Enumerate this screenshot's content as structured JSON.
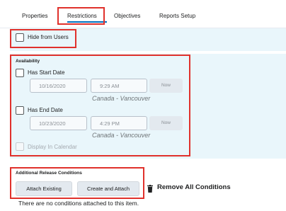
{
  "tabs": [
    {
      "label": "Properties"
    },
    {
      "label": "Restrictions",
      "active": true
    },
    {
      "label": "Objectives"
    },
    {
      "label": "Reports Setup"
    }
  ],
  "hide": {
    "label": "Hide from Users",
    "checked": false
  },
  "availability": {
    "heading": "Availability",
    "start": {
      "label": "Has Start Date",
      "checked": false,
      "date": "10/16/2020",
      "time": "9:29 AM",
      "now": "Now",
      "timezone": "Canada - Vancouver"
    },
    "end": {
      "label": "Has End Date",
      "checked": false,
      "date": "10/23/2020",
      "time": "4:29 PM",
      "now": "Now",
      "timezone": "Canada - Vancouver"
    },
    "calendar": {
      "label": "Display In Calendar",
      "checked": false,
      "disabled": true
    }
  },
  "release": {
    "heading": "Additional Release Conditions",
    "attach_existing": "Attach Existing",
    "create_attach": "Create and Attach",
    "remove_all": "Remove All Conditions",
    "remove_icon": "trash-icon",
    "empty_message": "There are no conditions attached to this item."
  },
  "colors": {
    "accent": "#006fbf",
    "highlight": "#e0312c",
    "panel": "#e9f6fb"
  }
}
